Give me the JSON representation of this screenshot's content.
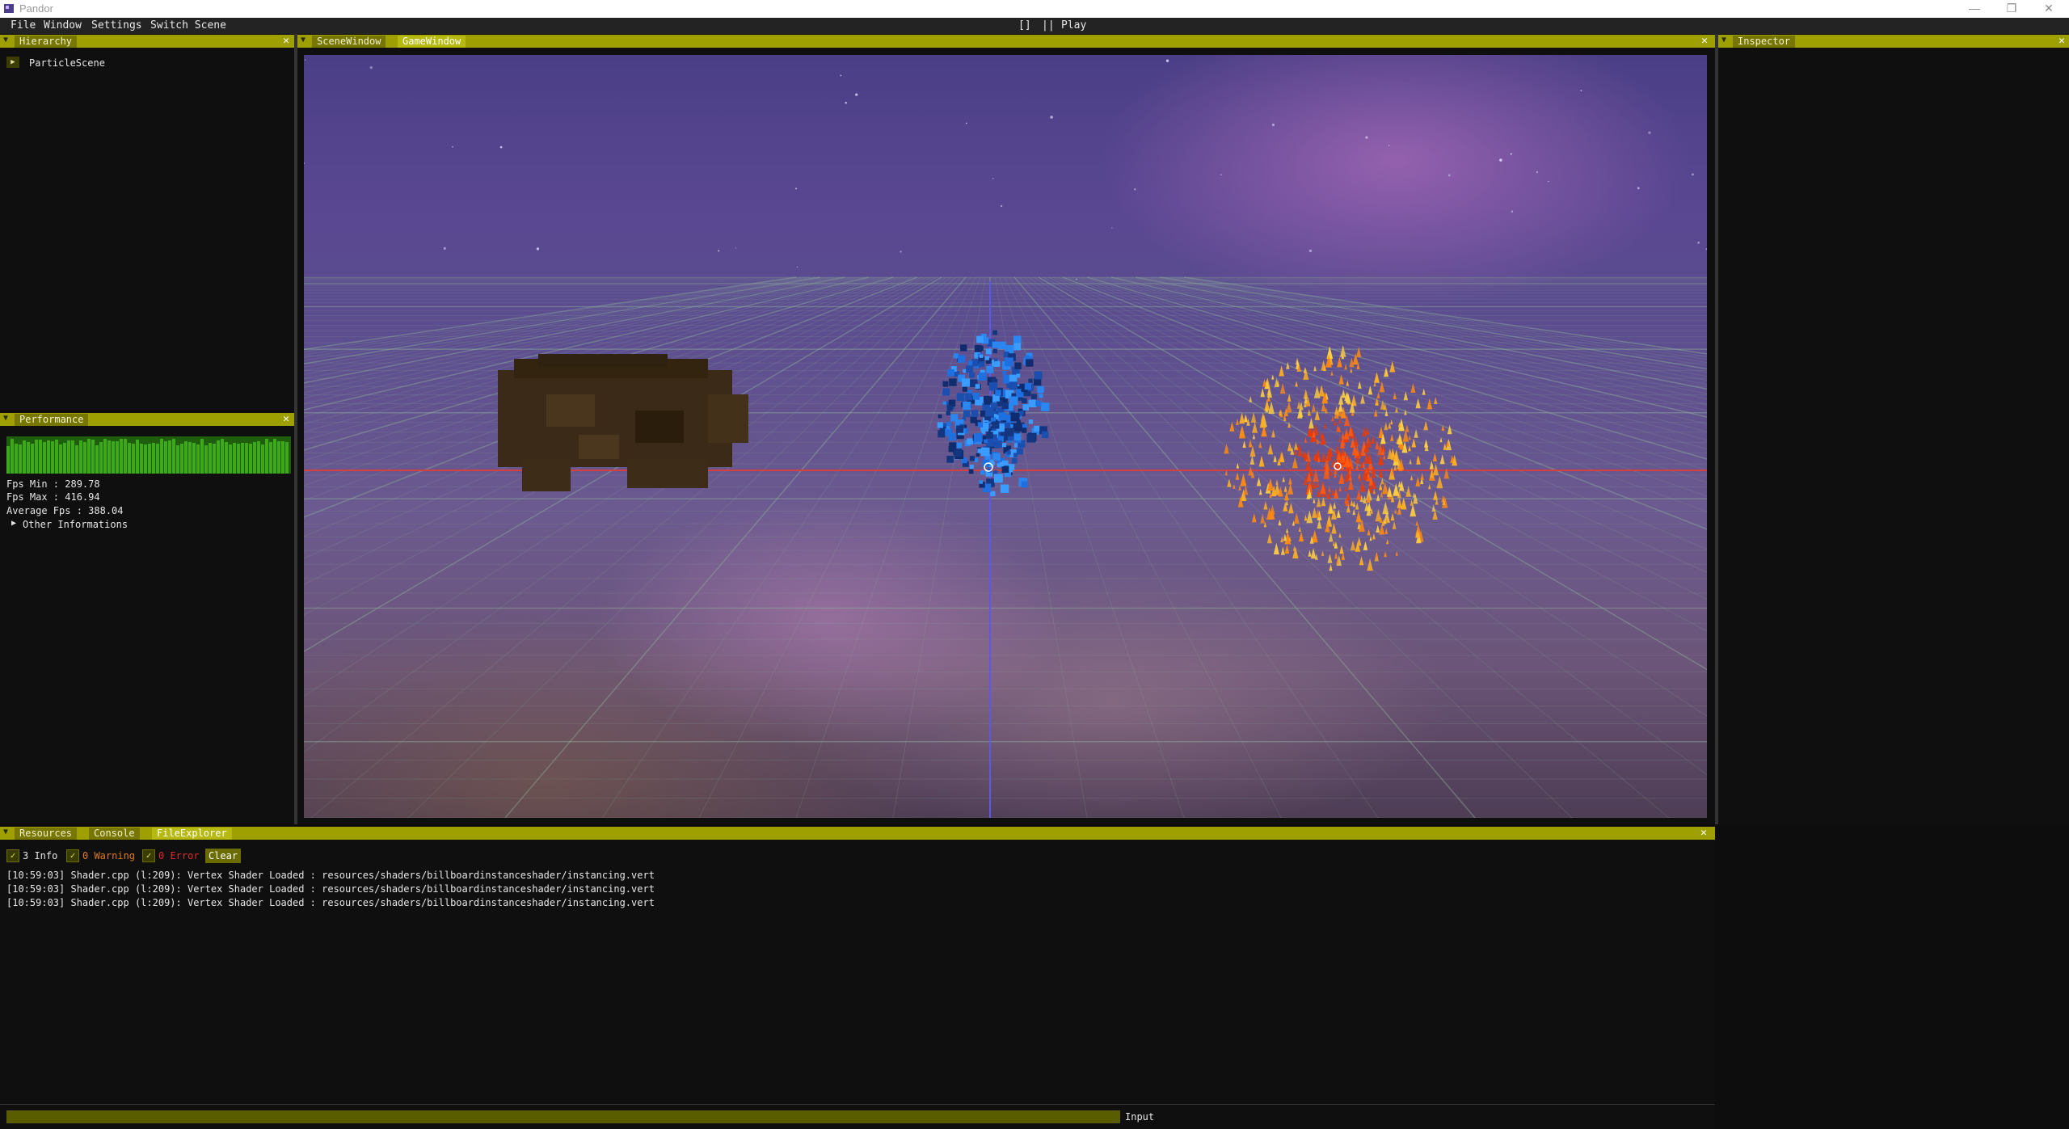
{
  "window": {
    "title": "Pandor"
  },
  "menu": {
    "items": [
      "File",
      "Window",
      "Settings",
      "Switch Scene"
    ]
  },
  "play_controls": {
    "stop": "[]",
    "pause": "||",
    "play": "Play"
  },
  "hierarchy": {
    "title": "Hierarchy",
    "items": [
      "ParticleScene"
    ]
  },
  "viewport_tabs": [
    "SceneWindow",
    "GameWindow"
  ],
  "inspector": {
    "title": "Inspector"
  },
  "performance": {
    "title": "Performance",
    "fps_min": "Fps Min : 289.78",
    "fps_max": "Fps Max : 416.94",
    "avg_fps": "Average Fps : 388.04",
    "other_info": "Other Informations"
  },
  "bottom_tabs": [
    "Resources",
    "Console",
    "FileExplorer"
  ],
  "console": {
    "filters": {
      "info": "3 Info",
      "warning": "0 Warning",
      "error": "0 Error"
    },
    "clear_label": "Clear",
    "logs": [
      "[10:59:03] Shader.cpp (l:209): Vertex Shader Loaded : resources/shaders/billboardinstanceshader/instancing.vert",
      "[10:59:03] Shader.cpp (l:209): Vertex Shader Loaded : resources/shaders/billboardinstanceshader/instancing.vert",
      "[10:59:03] Shader.cpp (l:209): Vertex Shader Loaded : resources/shaders/billboardinstanceshader/instancing.vert"
    ],
    "input_label": "Input"
  },
  "colors": {
    "accent_bar": "#9da000",
    "active_tab": "#b6ba10",
    "warning": "#e07a1c",
    "error": "#e02a2a",
    "graph": "#3da81a"
  }
}
